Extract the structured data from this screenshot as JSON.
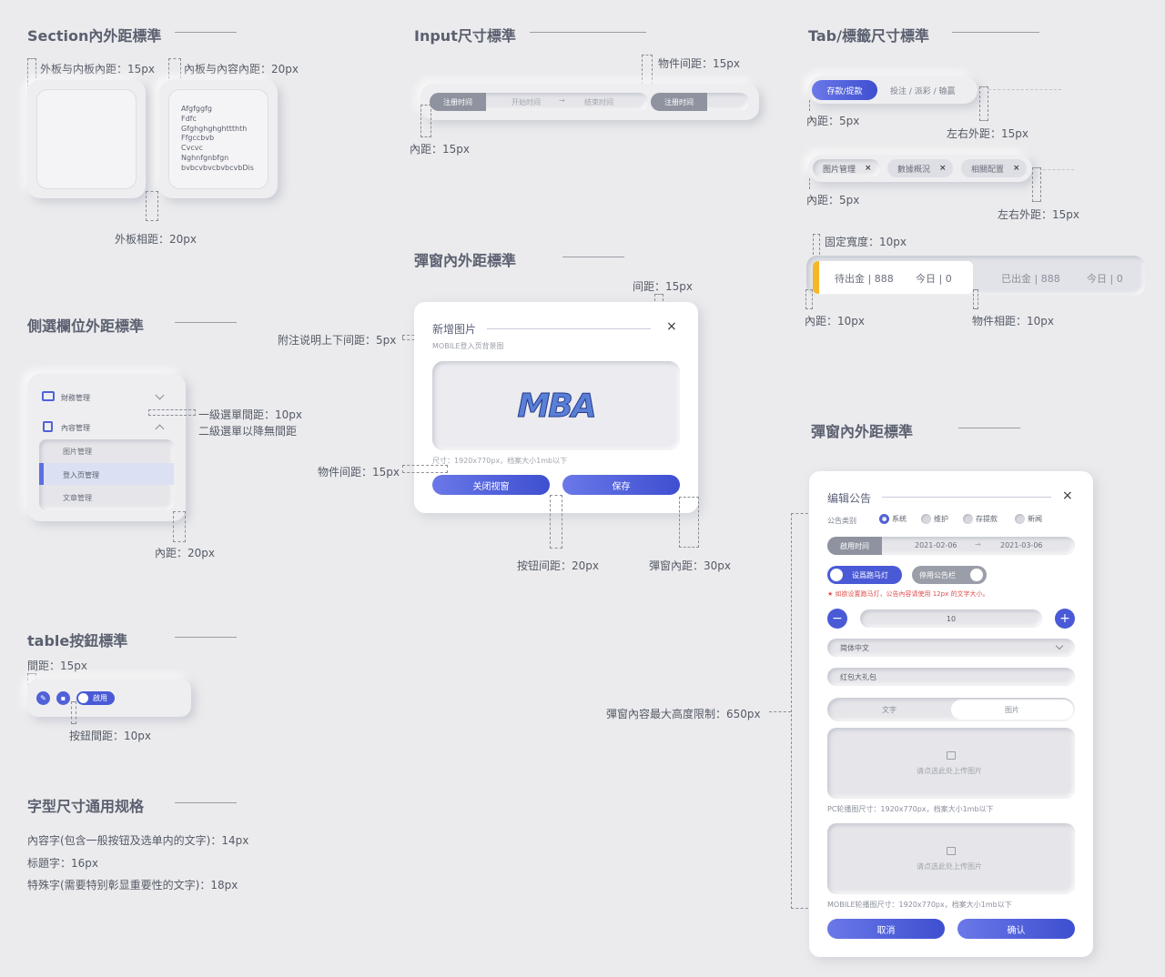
{
  "section1": {
    "title": "Section內外距標準",
    "note_outer_inner": "外板与内板內距：15px",
    "note_inner_content": "內板与內容內距：20px",
    "note_outer_gap": "外板相距：20px",
    "content_lines": [
      "Afgfggfg",
      "Fdfc",
      "Gfghghghghttthth",
      "Ffgccbvb",
      "Cvcvc",
      "Nghnfgnbfgn",
      "bvbcvbvcbvbcvbDis"
    ]
  },
  "input_std": {
    "title": "Input尺寸標準",
    "note_gap": "物件间距：15px",
    "note_padding": "內距：15px",
    "label": "注册时间",
    "start_placeholder": "开始时间",
    "end_placeholder": "结束时间",
    "arrow": "→",
    "label2": "注册时间"
  },
  "tab_std": {
    "title": "Tab/標籤尺寸標準",
    "tab1_active": "存款/提款",
    "tab1_rest": "投注 / 派彩 / 输赢",
    "note_padding1": "內距：5px",
    "note_margin1": "左右外距：15px",
    "tag_items": [
      "图片管理",
      "數據概況",
      "相關配置"
    ],
    "tag_close": "×",
    "note_padding2": "內距：5px",
    "note_margin2": "左右外距：15px",
    "note_fixed_width": "固定寬度：10px",
    "card_active_a": "待出金 | 888",
    "card_active_b": "今日 | 0",
    "card_b": "已出金 | 888",
    "card_b2": "今日 | 0",
    "note_padding3": "內距：10px",
    "note_gap3": "物件相距：10px"
  },
  "modal1": {
    "section_title": "彈窗內外距標準",
    "note_gap_top": "间距：15px",
    "note_caption_gap": "附注说明上下间距：5px",
    "note_item_gap": "物件间距：15px",
    "note_button_gap": "按钮间距：20px",
    "note_modal_padding": "彈窗內距：30px",
    "title": "新增图片",
    "close": "×",
    "subtitle": "MOBILE登入页背景图",
    "logo": "MBA",
    "caption": "尺寸：1920x770px，档案大小1mb以下",
    "cancel": "关闭视窗",
    "save": "保存"
  },
  "sidebar": {
    "title": "側選欄位外距標準",
    "item1": "財務管理",
    "item2": "內容管理",
    "sub_items": [
      "图片管理",
      "登入页管理",
      "文章管理"
    ],
    "note_lvl1": "一級選單間距：10px",
    "note_lvl2": "二級選單以降無間距",
    "note_padding": "內距：20px"
  },
  "table_btn": {
    "title": "table按鈕標準",
    "note_spacing": "間距：15px",
    "note_btn_gap": "按鈕間距：10px",
    "toggle_label": "啟用"
  },
  "font_std": {
    "title": "字型尺寸通用规格",
    "lines": [
      "內容字(包含一般按钮及选单内的文字)：14px",
      "标題字：16px",
      "特殊字(需要特别彰显重要性的文字)：18px"
    ]
  },
  "modal2": {
    "section_title": "彈窗內外距標準",
    "note_max_height": "彈窗內容最大高度限制：650px",
    "title": "编辑公告",
    "close": "×",
    "category_label": "公告类别",
    "radios": [
      "系统",
      "维护",
      "存提款",
      "新闻"
    ],
    "date_label": "啟用时间",
    "date_start": "2021-02-06",
    "date_arrow": "→",
    "date_end": "2021-03-06",
    "toggle_on": "设爲跑马灯",
    "toggle_off": "停用公告栏",
    "warning": "★ 如欲设置跑马灯，公告內容请使用 12px 的文字大小。",
    "stepper_value": "10",
    "stepper_minus": "−",
    "stepper_plus": "+",
    "language": "简体中文",
    "gift_value": "红包大礼包",
    "seg_text": "文字",
    "seg_image": "图片",
    "upload_hint1": "请点选此处上传图片",
    "pc_caption": "PC轮播图尺寸：1920x770px，档案大小1mb以下",
    "upload_hint2": "请点选此处上传图片",
    "mobile_caption": "MOBILE轮播图尺寸：1920x770px，档案大小1mb以下",
    "cancel": "取消",
    "confirm": "确认"
  },
  "colors": {
    "accent": "#4a5ad6",
    "yellow_marker": "#f4b728",
    "warning": "#e05050",
    "background": "#ebebed"
  }
}
